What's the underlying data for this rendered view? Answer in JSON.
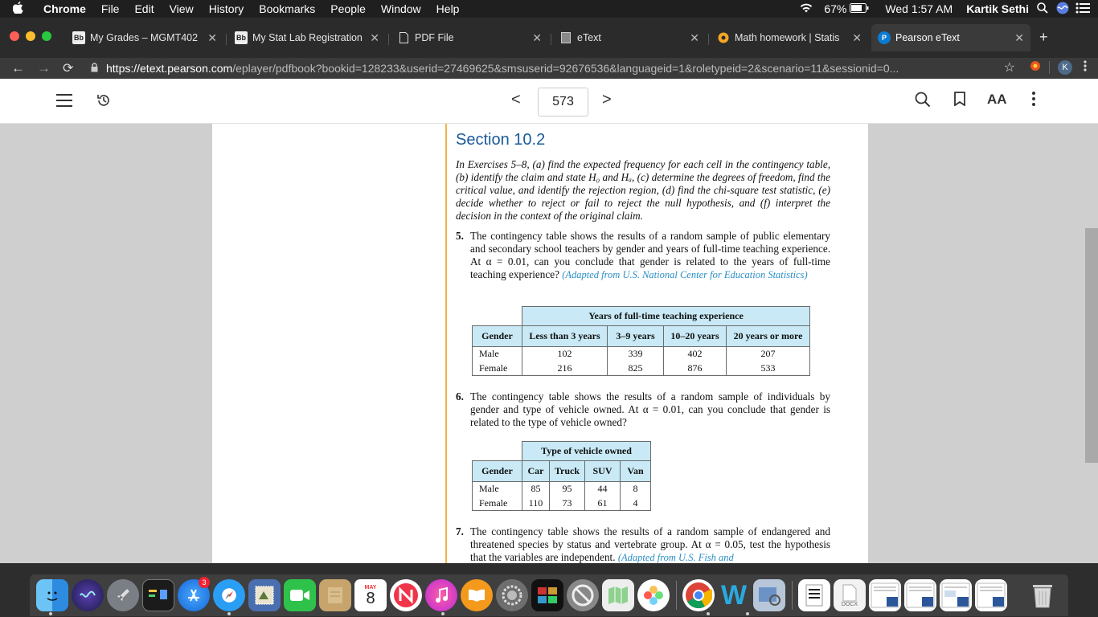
{
  "menubar": {
    "app": "Chrome",
    "items": [
      "File",
      "Edit",
      "View",
      "History",
      "Bookmarks",
      "People",
      "Window",
      "Help"
    ],
    "battery": "67%",
    "clock": "Wed 1:57 AM",
    "user": "Kartik Sethi"
  },
  "tabs": [
    {
      "label": "My Grades – MGMT402",
      "icon": "Bb"
    },
    {
      "label": "My Stat Lab Registration",
      "icon": "Bb"
    },
    {
      "label": "PDF File",
      "icon": ""
    },
    {
      "label": "eText",
      "icon": ""
    },
    {
      "label": "Math homework | Statis",
      "icon": ""
    },
    {
      "label": "Pearson eText",
      "icon": "P"
    }
  ],
  "omnibox": {
    "url_host": "https://etext.pearson.com",
    "url_path": "/eplayer/pdfbook?bookid=128233&userid=27469625&smsuserid=92676536&languageid=1&roletypeid=2&scenario=11&sessionid=0...",
    "profile_initial": "K"
  },
  "etext_toolbar": {
    "page_number": "573",
    "prev": "<",
    "next": ">",
    "font_label": "AA"
  },
  "content": {
    "section_title": "Section 10.2",
    "intro": "In Exercises 5–8, (a) find the expected frequency for each cell in the contingency table, (b) identify the claim and state H₀ and Hₐ, (c) determine the degrees of freedom, find the critical value, and identify the rejection region, (d) find the chi-square test statistic, (e) decide whether to reject or fail to reject the null hypothesis, and (f) interpret the decision in the context of the original claim.",
    "ex5": {
      "num": "5.",
      "text": "The contingency table shows the results of a random sample of public elementary and secondary school teachers by gender and years of full-time teaching experience. At α = 0.01, can you conclude that gender is related to the years of full-time teaching experience?",
      "source": "(Adapted from U.S. National Center for Education Statistics)",
      "table": {
        "group_header": "Years of full-time teaching experience",
        "row_header": "Gender",
        "columns": [
          "Less than 3 years",
          "3–9 years",
          "10–20 years",
          "20 years or more"
        ],
        "rows": [
          {
            "label": "Male",
            "values": [
              "102",
              "339",
              "402",
              "207"
            ]
          },
          {
            "label": "Female",
            "values": [
              "216",
              "825",
              "876",
              "533"
            ]
          }
        ]
      }
    },
    "ex6": {
      "num": "6.",
      "text": "The contingency table shows the results of a random sample of individuals by gender and type of vehicle owned. At α = 0.01, can you conclude that gender is related to the type of vehicle owned?",
      "table": {
        "group_header": "Type of vehicle owned",
        "row_header": "Gender",
        "columns": [
          "Car",
          "Truck",
          "SUV",
          "Van"
        ],
        "rows": [
          {
            "label": "Male",
            "values": [
              "85",
              "95",
              "44",
              "8"
            ]
          },
          {
            "label": "Female",
            "values": [
              "110",
              "73",
              "61",
              "4"
            ]
          }
        ]
      }
    },
    "ex7": {
      "num": "7.",
      "text": "The contingency table shows the results of a random sample of endangered and threatened species by status and vertebrate group. At α = 0.05, test the hypothesis that the variables are independent.",
      "source": "(Adapted from U.S. Fish and"
    }
  },
  "dock": {
    "calendar_month": "MAY",
    "calendar_day": "8",
    "appstore_badge": "3",
    "file_label": "DOCX",
    "word_glyph": "W"
  }
}
